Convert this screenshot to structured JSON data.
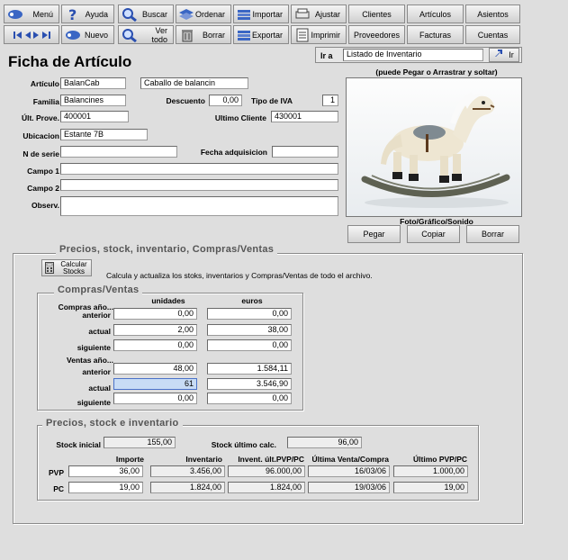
{
  "toolbar": {
    "row1": [
      {
        "label": "Menú",
        "icon": "menu-icon"
      },
      {
        "label": "Ayuda",
        "icon": "help-icon"
      },
      {
        "label": "Buscar",
        "icon": "search-icon"
      },
      {
        "label": "Ordenar",
        "icon": "sort-icon"
      },
      {
        "label": "Importar",
        "icon": "import-icon"
      },
      {
        "label": "Ajustar",
        "icon": "print-adjust-icon"
      },
      {
        "label": "Clientes"
      },
      {
        "label": "Artículos"
      },
      {
        "label": "Asientos"
      }
    ],
    "row2": [
      {
        "label": "",
        "icon": "nav-arrows-icon"
      },
      {
        "label": "Nuevo",
        "icon": "new-icon"
      },
      {
        "label": "Ver todo",
        "icon": "view-all-icon"
      },
      {
        "label": "Borrar",
        "icon": "trash-icon"
      },
      {
        "label": "Exportar",
        "icon": "export-icon"
      },
      {
        "label": "Imprimir",
        "icon": "print-icon"
      },
      {
        "label": "Proveedores"
      },
      {
        "label": "Facturas"
      },
      {
        "label": "Cuentas"
      }
    ]
  },
  "goto": {
    "label": "Ir a",
    "value": "Listado de Inventario",
    "button": "Ir"
  },
  "page_title": "Ficha de Artículo",
  "photo": {
    "hint": "(puede Pegar o Arrastrar y soltar)",
    "caption": "Foto/Gráfico/Sonido",
    "buttons": [
      "Pegar",
      "Copiar",
      "Borrar"
    ]
  },
  "article": {
    "articulo_label": "Artículo",
    "articulo_code": "BalanCab",
    "articulo_desc": "Caballo de balancin",
    "familia_label": "Familia",
    "familia": "Balancines",
    "descuento_label": "Descuento",
    "descuento": "0,00",
    "iva_label": "Tipo de IVA",
    "iva": "1",
    "ult_prove_label": "Últ. Prove.",
    "ult_prove": "400001",
    "ultimo_cliente_label": "Ultimo Cliente",
    "ultimo_cliente": "430001",
    "ubicacion_label": "Ubicacion",
    "ubicacion": "Estante 7B",
    "nserie_label": "N de serie",
    "nserie": "",
    "fecha_label": "Fecha adquisicion",
    "fecha": "",
    "campo1_label": "Campo 1",
    "campo1": "",
    "campo2_label": "Campo 2",
    "campo2": "",
    "observ_label": "Observ.",
    "observ": ""
  },
  "section": {
    "title": "Precios, stock, inventario, Compras/Ventas",
    "calc_button": "Calcular Stocks",
    "calc_desc": "Calcula y actualiza los stoks, inventarios y Compras/Ventas de  todo el archivo."
  },
  "compras_ventas": {
    "title": "Compras/Ventas",
    "col_units": "unidades",
    "col_euros": "euros",
    "compras_header": "Compras año...",
    "ventas_header": "Ventas año...",
    "rows": [
      {
        "label": "anterior",
        "units": "0,00",
        "euros": "0,00"
      },
      {
        "label": "actual",
        "units": "2,00",
        "euros": "38,00"
      },
      {
        "label": "siguiente",
        "units": "0,00",
        "euros": "0,00"
      },
      {
        "label": "anterior",
        "units": "48,00",
        "euros": "1.584,11"
      },
      {
        "label": "actual",
        "units": "61",
        "euros": "3.546,90"
      },
      {
        "label": "siguiente",
        "units": "0,00",
        "euros": "0,00"
      }
    ]
  },
  "precios_stock": {
    "title": "Precios, stock e inventario",
    "stock_inicial_label": "Stock inicial",
    "stock_inicial": "155,00",
    "stock_ultimo_label": "Stock último calc.",
    "stock_ultimo": "96,00",
    "headers": [
      "Importe",
      "Inventario",
      "Invent. últ.PVP/PC",
      "Última Venta/Compra",
      "Último PVP/PC"
    ],
    "rows": [
      {
        "label": "PVP",
        "values": [
          "36,00",
          "3.456,00",
          "96.000,00",
          "16/03/06",
          "1.000,00"
        ]
      },
      {
        "label": "PC",
        "values": [
          "19,00",
          "1.824,00",
          "1.824,00",
          "19/03/06",
          "19,00"
        ]
      }
    ]
  }
}
